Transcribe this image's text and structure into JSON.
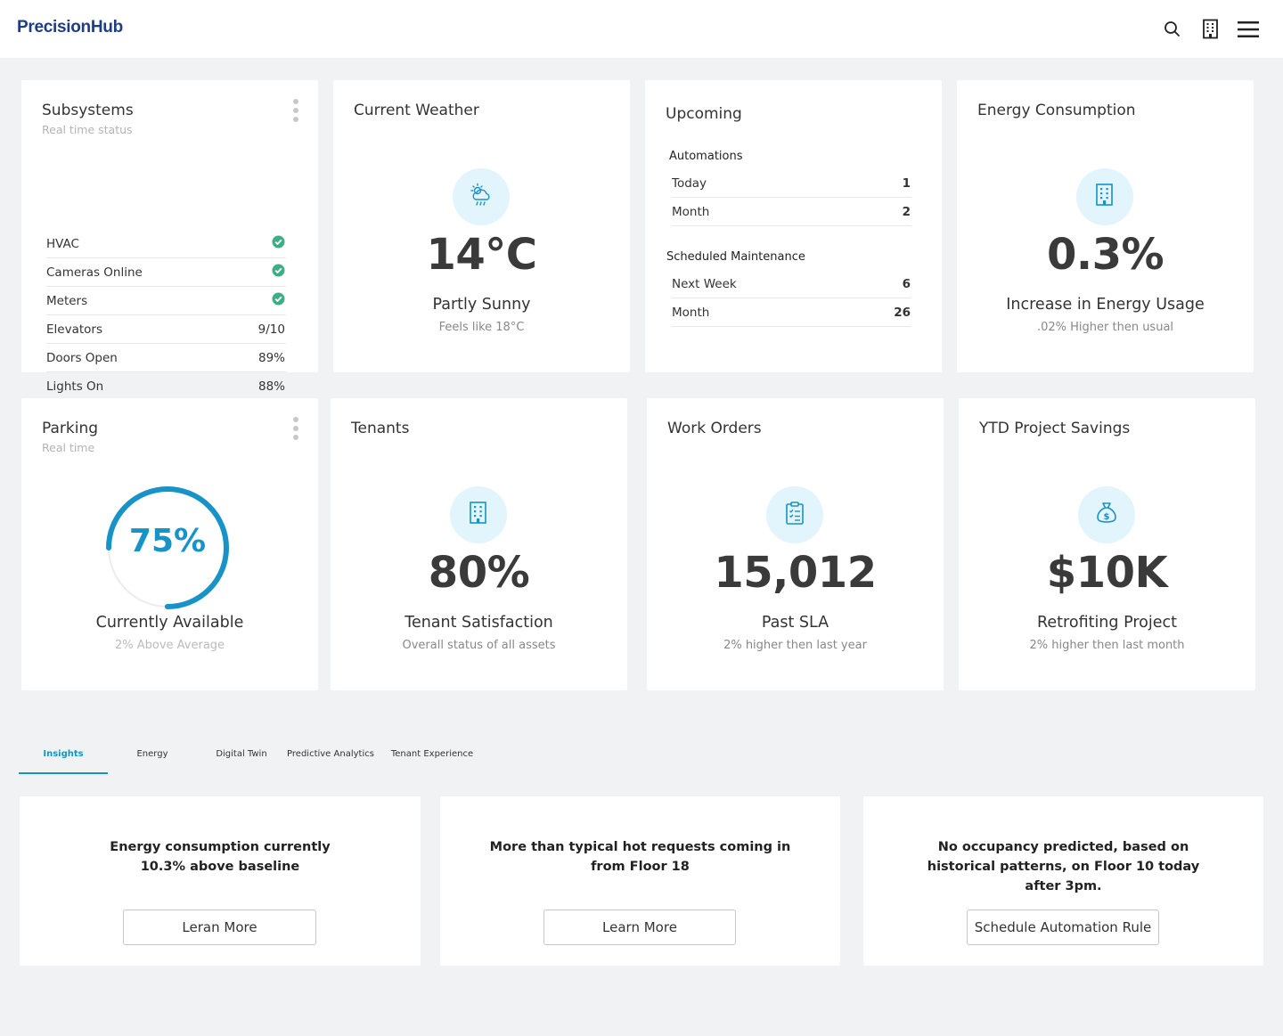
{
  "app": {
    "logo": "PrecisionHub"
  },
  "header": {
    "icons": [
      "search-icon",
      "building-icon",
      "hamburger-menu-icon"
    ]
  },
  "subsystems": {
    "title": "Subsystems",
    "subtitle": "Real time status",
    "rows": [
      {
        "label": "HVAC",
        "value": "",
        "status": "ok"
      },
      {
        "label": "Cameras Online",
        "value": "",
        "status": "ok"
      },
      {
        "label": "Meters",
        "value": "",
        "status": "ok"
      },
      {
        "label": "Elevators",
        "value": "9/10"
      },
      {
        "label": "Doors Open",
        "value": "89%"
      },
      {
        "label": "Lights On",
        "value": "88%"
      }
    ]
  },
  "weather": {
    "title": "Current Weather",
    "icon": "cloud-sun-rain-icon",
    "temp": "14°C",
    "condition": "Partly Sunny",
    "feels": "Feels like 18°C"
  },
  "upcoming": {
    "title": "Upcoming",
    "automations": {
      "label": "Automations",
      "rows": [
        {
          "label": "Today",
          "value": "1"
        },
        {
          "label": "Month",
          "value": "2"
        }
      ]
    },
    "maintenance": {
      "label": "Scheduled Maintenance",
      "rows": [
        {
          "label": "Next Week",
          "value": "6"
        },
        {
          "label": "Month",
          "value": "26"
        }
      ]
    }
  },
  "energy": {
    "title": "Energy Consumption",
    "icon": "building-icon",
    "value": "0.3%",
    "label": "Increase in Energy Usage",
    "sub": ".02% Higher then usual"
  },
  "parking": {
    "title": "Parking",
    "subtitle": "Real time",
    "percent": 75,
    "percent_label": "75%",
    "label": "Currently Available",
    "sub": "2% Above Average",
    "accent": "#1793c7"
  },
  "tenants": {
    "title": "Tenants",
    "icon": "building-icon",
    "value": "80%",
    "label": "Tenant Satisfaction",
    "sub": "Overall status of all assets"
  },
  "workorders": {
    "title": "Work Orders",
    "icon": "clipboard-icon",
    "value": "15,012",
    "label": "Past SLA",
    "sub": "2% higher then last year"
  },
  "savings": {
    "title": "YTD Project Savings",
    "icon": "money-bag-icon",
    "value": "$10K",
    "label": "Retrofiting Project",
    "sub": "2% higher then last month"
  },
  "tabs": [
    {
      "label": "Insights",
      "active": true
    },
    {
      "label": "Energy"
    },
    {
      "label": "Digital Twin"
    },
    {
      "label": "Predictive Analytics"
    },
    {
      "label": "Tenant Experience"
    }
  ],
  "insights": [
    {
      "text": "Energy consumption currently 10.3% above baseline",
      "button": "Leran More"
    },
    {
      "text": "More than typical hot requests coming in from Floor 18",
      "button": "Learn More"
    },
    {
      "text": "No occupancy predicted, based on historical patterns, on Floor 10 today after 3pm.",
      "button": "Schedule Automation Rule"
    }
  ],
  "colors": {
    "accent": "#1793c7",
    "success": "#3dae85",
    "icon_bg": "#e2f4fc",
    "logo": "#1f3c88"
  }
}
